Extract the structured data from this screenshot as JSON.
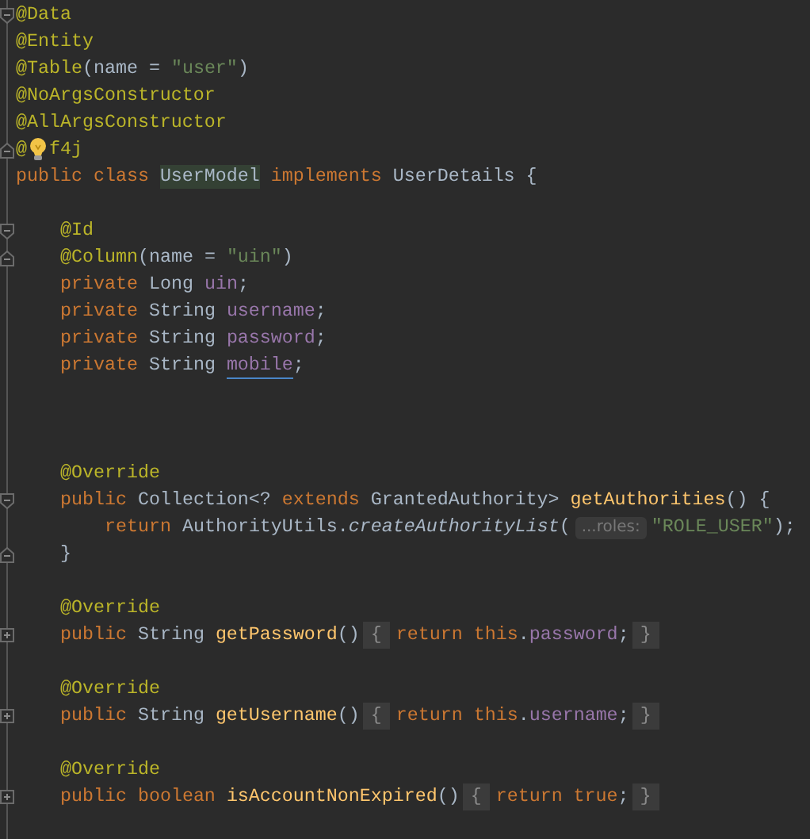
{
  "editor": {
    "lines": [
      {
        "kind": "code",
        "fold": {
          "kind": "open"
        },
        "segments": [
          {
            "kind": "annotation",
            "text": "@Data"
          }
        ]
      },
      {
        "kind": "code",
        "segments": [
          {
            "kind": "annotation",
            "text": "@Entity"
          }
        ]
      },
      {
        "kind": "code",
        "segments": [
          {
            "kind": "annotation",
            "text": "@Table"
          },
          {
            "kind": "plain",
            "text": "(name = "
          },
          {
            "kind": "string",
            "text": "\"user\""
          },
          {
            "kind": "plain",
            "text": ")"
          }
        ]
      },
      {
        "kind": "code",
        "segments": [
          {
            "kind": "annotation",
            "text": "@NoArgsConstructor"
          }
        ]
      },
      {
        "kind": "code",
        "segments": [
          {
            "kind": "annotation",
            "text": "@AllArgsConstructor"
          }
        ]
      },
      {
        "kind": "code",
        "fold": {
          "kind": "close"
        },
        "segments": [
          {
            "kind": "annotation",
            "text": "@"
          },
          {
            "kind": "bulb"
          },
          {
            "kind": "annotation",
            "text": "f4j"
          }
        ]
      },
      {
        "kind": "code",
        "segments": [
          {
            "kind": "keyword",
            "text": "public class "
          },
          {
            "kind": "highlight",
            "text": "UserModel"
          },
          {
            "kind": "keyword",
            "text": " implements "
          },
          {
            "kind": "plain",
            "text": "UserDetails {"
          }
        ],
        "children": [
          {
            "kind": "blank"
          },
          {
            "kind": "code",
            "fold": {
              "kind": "open"
            },
            "segments": [
              {
                "kind": "annotation",
                "text": "@Id"
              }
            ]
          },
          {
            "kind": "code",
            "fold": {
              "kind": "close"
            },
            "segments": [
              {
                "kind": "annotation",
                "text": "@Column"
              },
              {
                "kind": "plain",
                "text": "(name = "
              },
              {
                "kind": "string",
                "text": "\"uin\""
              },
              {
                "kind": "plain",
                "text": ")"
              }
            ]
          },
          {
            "kind": "code",
            "segments": [
              {
                "kind": "keyword",
                "text": "private "
              },
              {
                "kind": "plain",
                "text": "Long "
              },
              {
                "kind": "field",
                "text": "uin"
              },
              {
                "kind": "plain",
                "text": ";"
              }
            ]
          },
          {
            "kind": "code",
            "segments": [
              {
                "kind": "keyword",
                "text": "private "
              },
              {
                "kind": "plain",
                "text": "String "
              },
              {
                "kind": "field",
                "text": "username"
              },
              {
                "kind": "plain",
                "text": ";"
              }
            ]
          },
          {
            "kind": "code",
            "segments": [
              {
                "kind": "keyword",
                "text": "private "
              },
              {
                "kind": "plain",
                "text": "String "
              },
              {
                "kind": "field",
                "text": "password"
              },
              {
                "kind": "plain",
                "text": ";"
              }
            ]
          },
          {
            "kind": "code",
            "segments": [
              {
                "kind": "keyword",
                "text": "private "
              },
              {
                "kind": "plain",
                "text": "String "
              },
              {
                "kind": "field",
                "text": "mobile",
                "underlined": true
              },
              {
                "kind": "plain",
                "text": ";"
              }
            ]
          },
          {
            "kind": "blank"
          },
          {
            "kind": "blank"
          },
          {
            "kind": "blank"
          },
          {
            "kind": "code",
            "segments": [
              {
                "kind": "annotation",
                "text": "@Override"
              }
            ]
          },
          {
            "kind": "code",
            "fold": {
              "kind": "open"
            },
            "segments": [
              {
                "kind": "keyword",
                "text": "public "
              },
              {
                "kind": "plain",
                "text": "Collection<? "
              },
              {
                "kind": "keyword",
                "text": "extends "
              },
              {
                "kind": "plain",
                "text": "GrantedAuthority> "
              },
              {
                "kind": "method",
                "text": "getAuthorities"
              },
              {
                "kind": "plain",
                "text": "() {"
              }
            ],
            "children": [
              {
                "kind": "code",
                "segments": [
                  {
                    "kind": "keyword",
                    "text": "return "
                  },
                  {
                    "kind": "plain",
                    "text": "AuthorityUtils."
                  },
                  {
                    "kind": "call",
                    "text": "createAuthorityList"
                  },
                  {
                    "kind": "plain",
                    "text": "("
                  },
                  {
                    "kind": "hint",
                    "text": "...roles:"
                  },
                  {
                    "kind": "string",
                    "text": "\"ROLE_USER\""
                  },
                  {
                    "kind": "plain",
                    "text": ");"
                  }
                ]
              }
            ]
          },
          {
            "kind": "code",
            "fold": {
              "kind": "close"
            },
            "segments": [
              {
                "kind": "plain",
                "text": "}"
              }
            ]
          },
          {
            "kind": "blank"
          },
          {
            "kind": "code",
            "segments": [
              {
                "kind": "annotation",
                "text": "@Override"
              }
            ]
          },
          {
            "kind": "code",
            "fold": {
              "kind": "collapsed"
            },
            "segments": [
              {
                "kind": "keyword",
                "text": "public "
              },
              {
                "kind": "plain",
                "text": "String "
              },
              {
                "kind": "method",
                "text": "getPassword"
              },
              {
                "kind": "plain",
                "text": "()"
              },
              {
                "kind": "folded",
                "text": "{"
              },
              {
                "kind": "keyword",
                "text": "return this"
              },
              {
                "kind": "plain",
                "text": "."
              },
              {
                "kind": "field",
                "text": "password"
              },
              {
                "kind": "plain",
                "text": ";"
              },
              {
                "kind": "folded",
                "text": "}"
              }
            ]
          },
          {
            "kind": "blank"
          },
          {
            "kind": "code",
            "segments": [
              {
                "kind": "annotation",
                "text": "@Override"
              }
            ]
          },
          {
            "kind": "code",
            "fold": {
              "kind": "collapsed"
            },
            "segments": [
              {
                "kind": "keyword",
                "text": "public "
              },
              {
                "kind": "plain",
                "text": "String "
              },
              {
                "kind": "method",
                "text": "getUsername"
              },
              {
                "kind": "plain",
                "text": "()"
              },
              {
                "kind": "folded",
                "text": "{"
              },
              {
                "kind": "keyword",
                "text": "return this"
              },
              {
                "kind": "plain",
                "text": "."
              },
              {
                "kind": "field",
                "text": "username"
              },
              {
                "kind": "plain",
                "text": ";"
              },
              {
                "kind": "folded",
                "text": "}"
              }
            ]
          },
          {
            "kind": "blank"
          },
          {
            "kind": "code",
            "segments": [
              {
                "kind": "annotation",
                "text": "@Override"
              }
            ]
          },
          {
            "kind": "code",
            "fold": {
              "kind": "collapsed"
            },
            "segments": [
              {
                "kind": "keyword",
                "text": "public boolean "
              },
              {
                "kind": "method",
                "text": "isAccountNonExpired"
              },
              {
                "kind": "plain",
                "text": "()"
              },
              {
                "kind": "folded",
                "text": "{"
              },
              {
                "kind": "keyword",
                "text": "return true"
              },
              {
                "kind": "plain",
                "text": ";"
              },
              {
                "kind": "folded",
                "text": "}"
              }
            ]
          }
        ]
      }
    ]
  }
}
